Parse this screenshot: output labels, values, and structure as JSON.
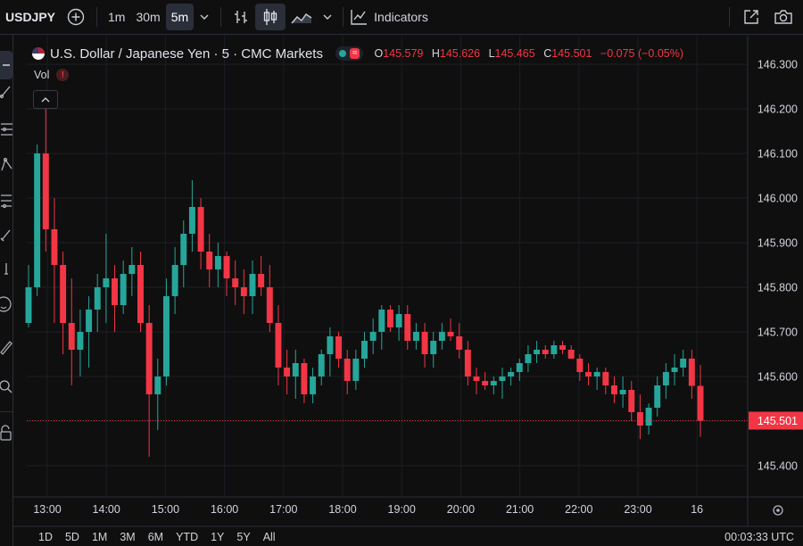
{
  "toolbar": {
    "symbol": "USDJPY",
    "intervals": [
      "1m",
      "30m",
      "5m"
    ],
    "active_interval": "5m",
    "indicators_label": "Indicators",
    "icons": [
      "add-symbol-icon",
      "chevron-down-icon",
      "bar-style-icon",
      "candle-style-icon",
      "area-style-icon",
      "chevron-down-icon",
      "indicators-icon",
      "fullscreen-icon",
      "camera-icon"
    ]
  },
  "legend": {
    "title": "U.S. Dollar / Japanese Yen · 5 · CMC Markets",
    "o_label": "O",
    "o": "145.579",
    "h_label": "H",
    "h": "145.626",
    "l_label": "L",
    "l": "145.465",
    "c_label": "C",
    "c": "145.501",
    "change": "−0.075 (−0.05%)",
    "status_wave": "≈",
    "vol_label": "Vol",
    "vol_warning": "!"
  },
  "bottom": {
    "ranges": [
      "1D",
      "5D",
      "1M",
      "3M",
      "6M",
      "YTD",
      "1Y",
      "5Y",
      "All"
    ],
    "clock": "00:03:33 UTC"
  },
  "colors": {
    "up": "#26a69a",
    "down": "#f23645",
    "background": "#0f0f0f",
    "price_line": "#f23645"
  },
  "chart_data": {
    "type": "candlestick",
    "symbol": "USDJPY",
    "interval": "5m",
    "yticks": [
      "146.300",
      "146.200",
      "146.100",
      "146.000",
      "145.900",
      "145.800",
      "145.700",
      "145.600",
      "145.500",
      "145.400"
    ],
    "ylim": [
      145.3,
      146.33
    ],
    "xticks": [
      "13:00",
      "14:00",
      "15:00",
      "16:00",
      "17:00",
      "18:00",
      "19:00",
      "20:00",
      "21:00",
      "22:00",
      "23:00",
      "16"
    ],
    "last_price": 145.501,
    "last_price_label": "145.501",
    "candles": [
      [
        145.72,
        145.85,
        145.71,
        145.8
      ],
      [
        145.8,
        146.12,
        145.78,
        146.1
      ],
      [
        146.1,
        146.23,
        145.88,
        145.93
      ],
      [
        145.93,
        146.0,
        145.72,
        145.85
      ],
      [
        145.85,
        145.88,
        145.65,
        145.72
      ],
      [
        145.72,
        145.82,
        145.58,
        145.66
      ],
      [
        145.66,
        145.75,
        145.6,
        145.7
      ],
      [
        145.7,
        145.78,
        145.62,
        145.75
      ],
      [
        145.75,
        145.83,
        145.7,
        145.8
      ],
      [
        145.8,
        145.92,
        145.72,
        145.82
      ],
      [
        145.82,
        145.85,
        145.7,
        145.76
      ],
      [
        145.76,
        145.86,
        145.74,
        145.83
      ],
      [
        145.83,
        145.89,
        145.78,
        145.85
      ],
      [
        145.85,
        145.88,
        145.7,
        145.72
      ],
      [
        145.72,
        145.76,
        145.42,
        145.56
      ],
      [
        145.56,
        145.64,
        145.48,
        145.6
      ],
      [
        145.6,
        145.82,
        145.58,
        145.78
      ],
      [
        145.78,
        145.89,
        145.74,
        145.85
      ],
      [
        145.85,
        145.95,
        145.8,
        145.92
      ],
      [
        145.92,
        146.04,
        145.88,
        145.98
      ],
      [
        145.98,
        146.0,
        145.84,
        145.88
      ],
      [
        145.88,
        145.92,
        145.8,
        145.84
      ],
      [
        145.84,
        145.9,
        145.8,
        145.87
      ],
      [
        145.87,
        145.88,
        145.78,
        145.82
      ],
      [
        145.82,
        145.86,
        145.76,
        145.8
      ],
      [
        145.8,
        145.84,
        145.74,
        145.78
      ],
      [
        145.78,
        145.86,
        145.74,
        145.83
      ],
      [
        145.83,
        145.87,
        145.78,
        145.8
      ],
      [
        145.8,
        145.85,
        145.7,
        145.72
      ],
      [
        145.72,
        145.76,
        145.58,
        145.62
      ],
      [
        145.62,
        145.66,
        145.56,
        145.6
      ],
      [
        145.6,
        145.66,
        145.55,
        145.63
      ],
      [
        145.63,
        145.64,
        145.54,
        145.56
      ],
      [
        145.56,
        145.62,
        145.54,
        145.6
      ],
      [
        145.6,
        145.66,
        145.58,
        145.65
      ],
      [
        145.65,
        145.71,
        145.6,
        145.69
      ],
      [
        145.69,
        145.7,
        145.62,
        145.64
      ],
      [
        145.64,
        145.66,
        145.56,
        145.59
      ],
      [
        145.59,
        145.66,
        145.57,
        145.64
      ],
      [
        145.64,
        145.7,
        145.62,
        145.68
      ],
      [
        145.68,
        145.73,
        145.65,
        145.7
      ],
      [
        145.7,
        145.76,
        145.66,
        145.75
      ],
      [
        145.75,
        145.76,
        145.7,
        145.71
      ],
      [
        145.71,
        145.76,
        145.68,
        145.74
      ],
      [
        145.74,
        145.76,
        145.66,
        145.68
      ],
      [
        145.68,
        145.72,
        145.66,
        145.7
      ],
      [
        145.7,
        145.72,
        145.62,
        145.65
      ],
      [
        145.65,
        145.7,
        145.62,
        145.68
      ],
      [
        145.68,
        145.72,
        145.66,
        145.7
      ],
      [
        145.7,
        145.73,
        145.68,
        145.69
      ],
      [
        145.69,
        145.72,
        145.64,
        145.66
      ],
      [
        145.66,
        145.68,
        145.58,
        145.6
      ],
      [
        145.6,
        145.62,
        145.56,
        145.59
      ],
      [
        145.59,
        145.61,
        145.57,
        145.58
      ],
      [
        145.58,
        145.6,
        145.56,
        145.59
      ],
      [
        145.59,
        145.62,
        145.55,
        145.6
      ],
      [
        145.6,
        145.62,
        145.58,
        145.61
      ],
      [
        145.61,
        145.64,
        145.59,
        145.63
      ],
      [
        145.63,
        145.67,
        145.61,
        145.65
      ],
      [
        145.65,
        145.68,
        145.63,
        145.66
      ],
      [
        145.66,
        145.67,
        145.64,
        145.65
      ],
      [
        145.65,
        145.68,
        145.64,
        145.67
      ],
      [
        145.67,
        145.68,
        145.65,
        145.66
      ],
      [
        145.66,
        145.67,
        145.64,
        145.64
      ],
      [
        145.64,
        145.65,
        145.59,
        145.61
      ],
      [
        145.61,
        145.63,
        145.58,
        145.6
      ],
      [
        145.6,
        145.62,
        145.57,
        145.61
      ],
      [
        145.61,
        145.62,
        145.56,
        145.58
      ],
      [
        145.58,
        145.6,
        145.54,
        145.56
      ],
      [
        145.56,
        145.6,
        145.53,
        145.57
      ],
      [
        145.57,
        145.59,
        145.5,
        145.52
      ],
      [
        145.52,
        145.56,
        145.46,
        145.49
      ],
      [
        145.49,
        145.54,
        145.47,
        145.53
      ],
      [
        145.53,
        145.6,
        145.51,
        145.58
      ],
      [
        145.58,
        145.63,
        145.55,
        145.61
      ],
      [
        145.61,
        145.65,
        145.58,
        145.62
      ],
      [
        145.62,
        145.66,
        145.6,
        145.64
      ],
      [
        145.64,
        145.66,
        145.55,
        145.579
      ],
      [
        145.579,
        145.626,
        145.465,
        145.501
      ]
    ]
  }
}
